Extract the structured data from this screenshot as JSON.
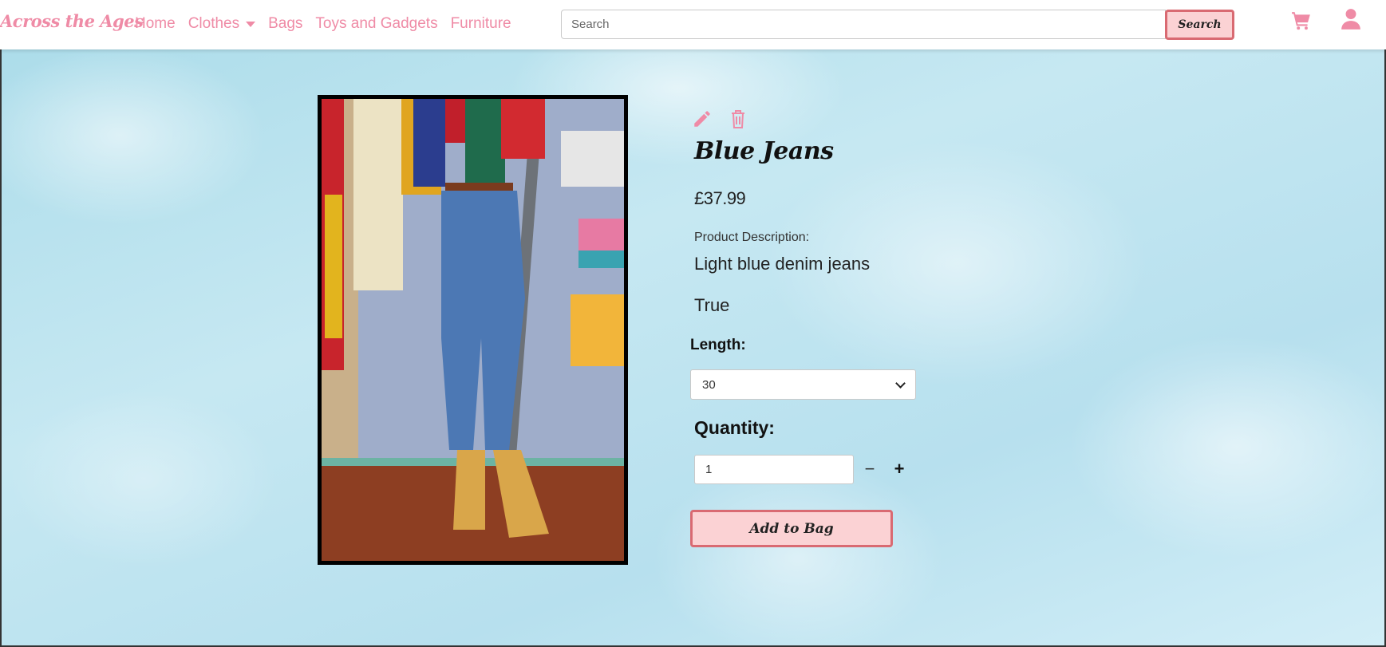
{
  "brand": {
    "name": "Across the Ages"
  },
  "nav": {
    "items": [
      {
        "label": "Home"
      },
      {
        "label": "Clothes",
        "has_dropdown": true
      },
      {
        "label": "Bags"
      },
      {
        "label": "Toys and Gadgets"
      },
      {
        "label": "Furniture"
      }
    ]
  },
  "search": {
    "placeholder": "Search",
    "value": "",
    "button_label": "Search"
  },
  "icons": {
    "cart": "shopping-cart-icon",
    "account": "user-icon",
    "edit": "pencil-icon",
    "delete": "trash-icon"
  },
  "product": {
    "title": "Blue Jeans",
    "price": "£37.99",
    "description_label": "Product Description:",
    "description": "Light blue denim jeans",
    "flag_text": "True",
    "length_label": "Length:",
    "length_selected": "30",
    "quantity_label": "Quantity:",
    "quantity_value": "1",
    "minus_symbol": "−",
    "plus_symbol": "+",
    "add_button_label": "Add to Bag"
  },
  "colors": {
    "accent_pink": "#ef8ba6",
    "button_fill": "#fbd2d4",
    "button_border": "#d96a72",
    "sky": "#cfe9f4"
  }
}
